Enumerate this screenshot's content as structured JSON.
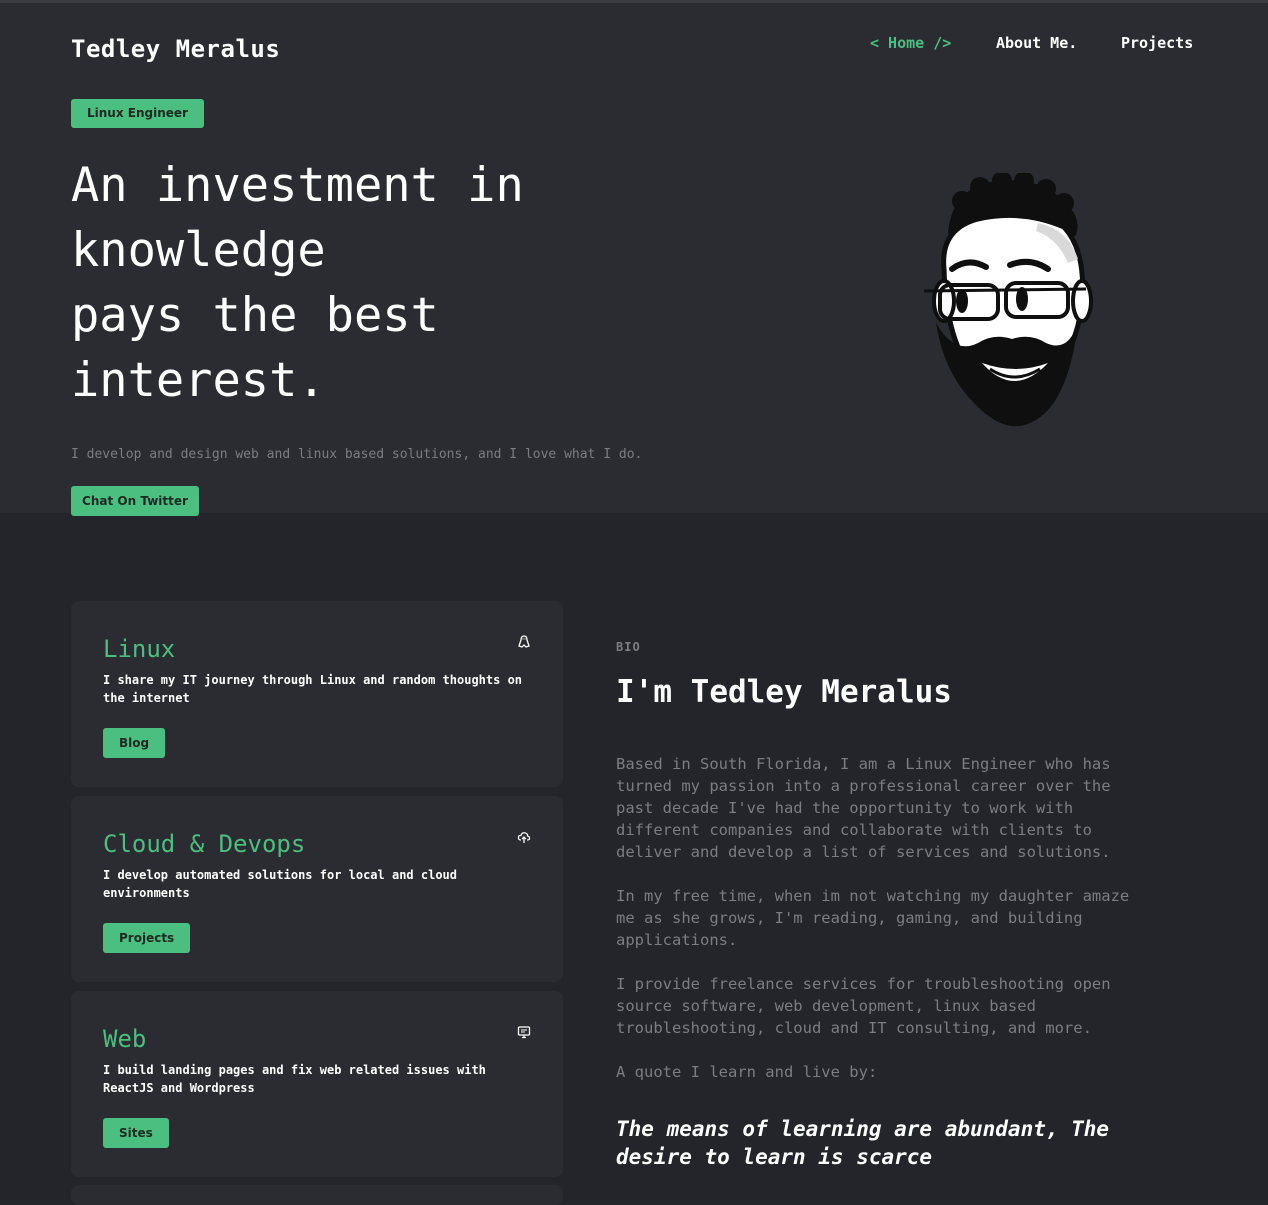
{
  "header": {
    "brand": "Tedley Meralus",
    "nav": {
      "home": "< Home />",
      "about": "About Me.",
      "projects": "Projects"
    }
  },
  "hero": {
    "tag": "Linux Engineer",
    "headline_lines": [
      "An investment in",
      "knowledge",
      "pays the best",
      "interest."
    ],
    "subtitle": "I develop and design web and linux based solutions, and I love what I do.",
    "cta": "Chat On Twitter"
  },
  "cards": [
    {
      "title": "Linux",
      "desc": "I share my IT journey through Linux and random thoughts on the internet",
      "button": "Blog",
      "icon": "linux-icon"
    },
    {
      "title": "Cloud & Devops",
      "desc": "I develop automated solutions for local and cloud environments",
      "button": "Projects",
      "icon": "cloud-upload-icon"
    },
    {
      "title": "Web",
      "desc": "I build landing pages and fix web related issues with ReactJS and Wordpress",
      "button": "Sites",
      "icon": "monitor-icon"
    }
  ],
  "bio": {
    "label": "BIO",
    "title": "I'm Tedley Meralus",
    "paragraphs": [
      "Based in South Florida, I am a Linux Engineer who has turned my passion into a professional career over the past decade I've had the opportunity to work with different companies and collaborate with clients to deliver and develop a list of services and solutions.",
      "In my free time, when im not watching my daughter amaze me as she grows, I'm reading, gaming, and building applications.",
      "I provide freelance services for troubleshooting open source software, web development, linux based troubleshooting, cloud and IT consulting, and more.",
      "A quote I learn and live by:"
    ],
    "quote": "The means of learning are abundant, The desire to learn is scarce"
  },
  "colors": {
    "accent": "#4bbf7f",
    "hero_bg": "#2b2c31",
    "page_bg": "#24252a",
    "muted_text": "#7b7d84"
  }
}
